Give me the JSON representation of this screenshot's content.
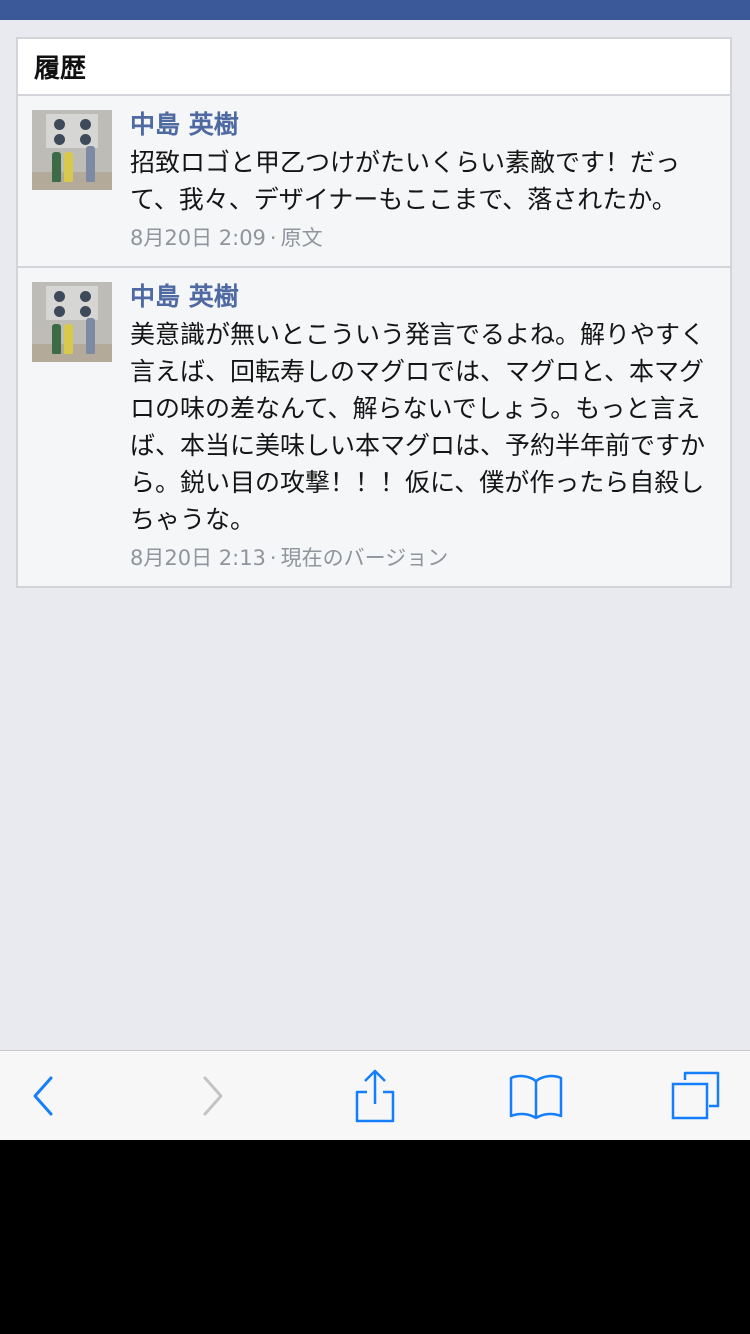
{
  "panel": {
    "title": "履歴"
  },
  "history": [
    {
      "author": "中島 英樹",
      "message": "招致ロゴと甲乙つけがたいくらい素敵です！だって、我々、デザイナーもここまで、落されたか。",
      "timestamp": "8月20日 2:09",
      "version_label": "原文"
    },
    {
      "author": "中島 英樹",
      "message": "美意識が無いとこういう発言でるよね。解りやすく言えば、回転寿しのマグロでは、マグロと、本マグロの味の差なんて、解らないでしょう。もっと言えば、本当に美味しい本マグロは、予約半年前ですから。鋭い目の攻撃！！！仮に、僕が作ったら自殺しちゃうな。",
      "timestamp": "8月20日 2:13",
      "version_label": "現在のバージョン"
    }
  ],
  "meta_separator": "·",
  "toolbar": {
    "back_icon": "chevron-left-icon",
    "forward_icon": "chevron-right-icon",
    "share_icon": "share-icon",
    "bookmarks_icon": "book-icon",
    "tabs_icon": "tabs-icon",
    "active_color": "#147efb",
    "disabled_color": "#c4c4c8"
  },
  "colors": {
    "brand_bar": "#3b5998",
    "author": "#4f6aa3",
    "meta": "#90949c",
    "background": "#e9eaf0"
  }
}
